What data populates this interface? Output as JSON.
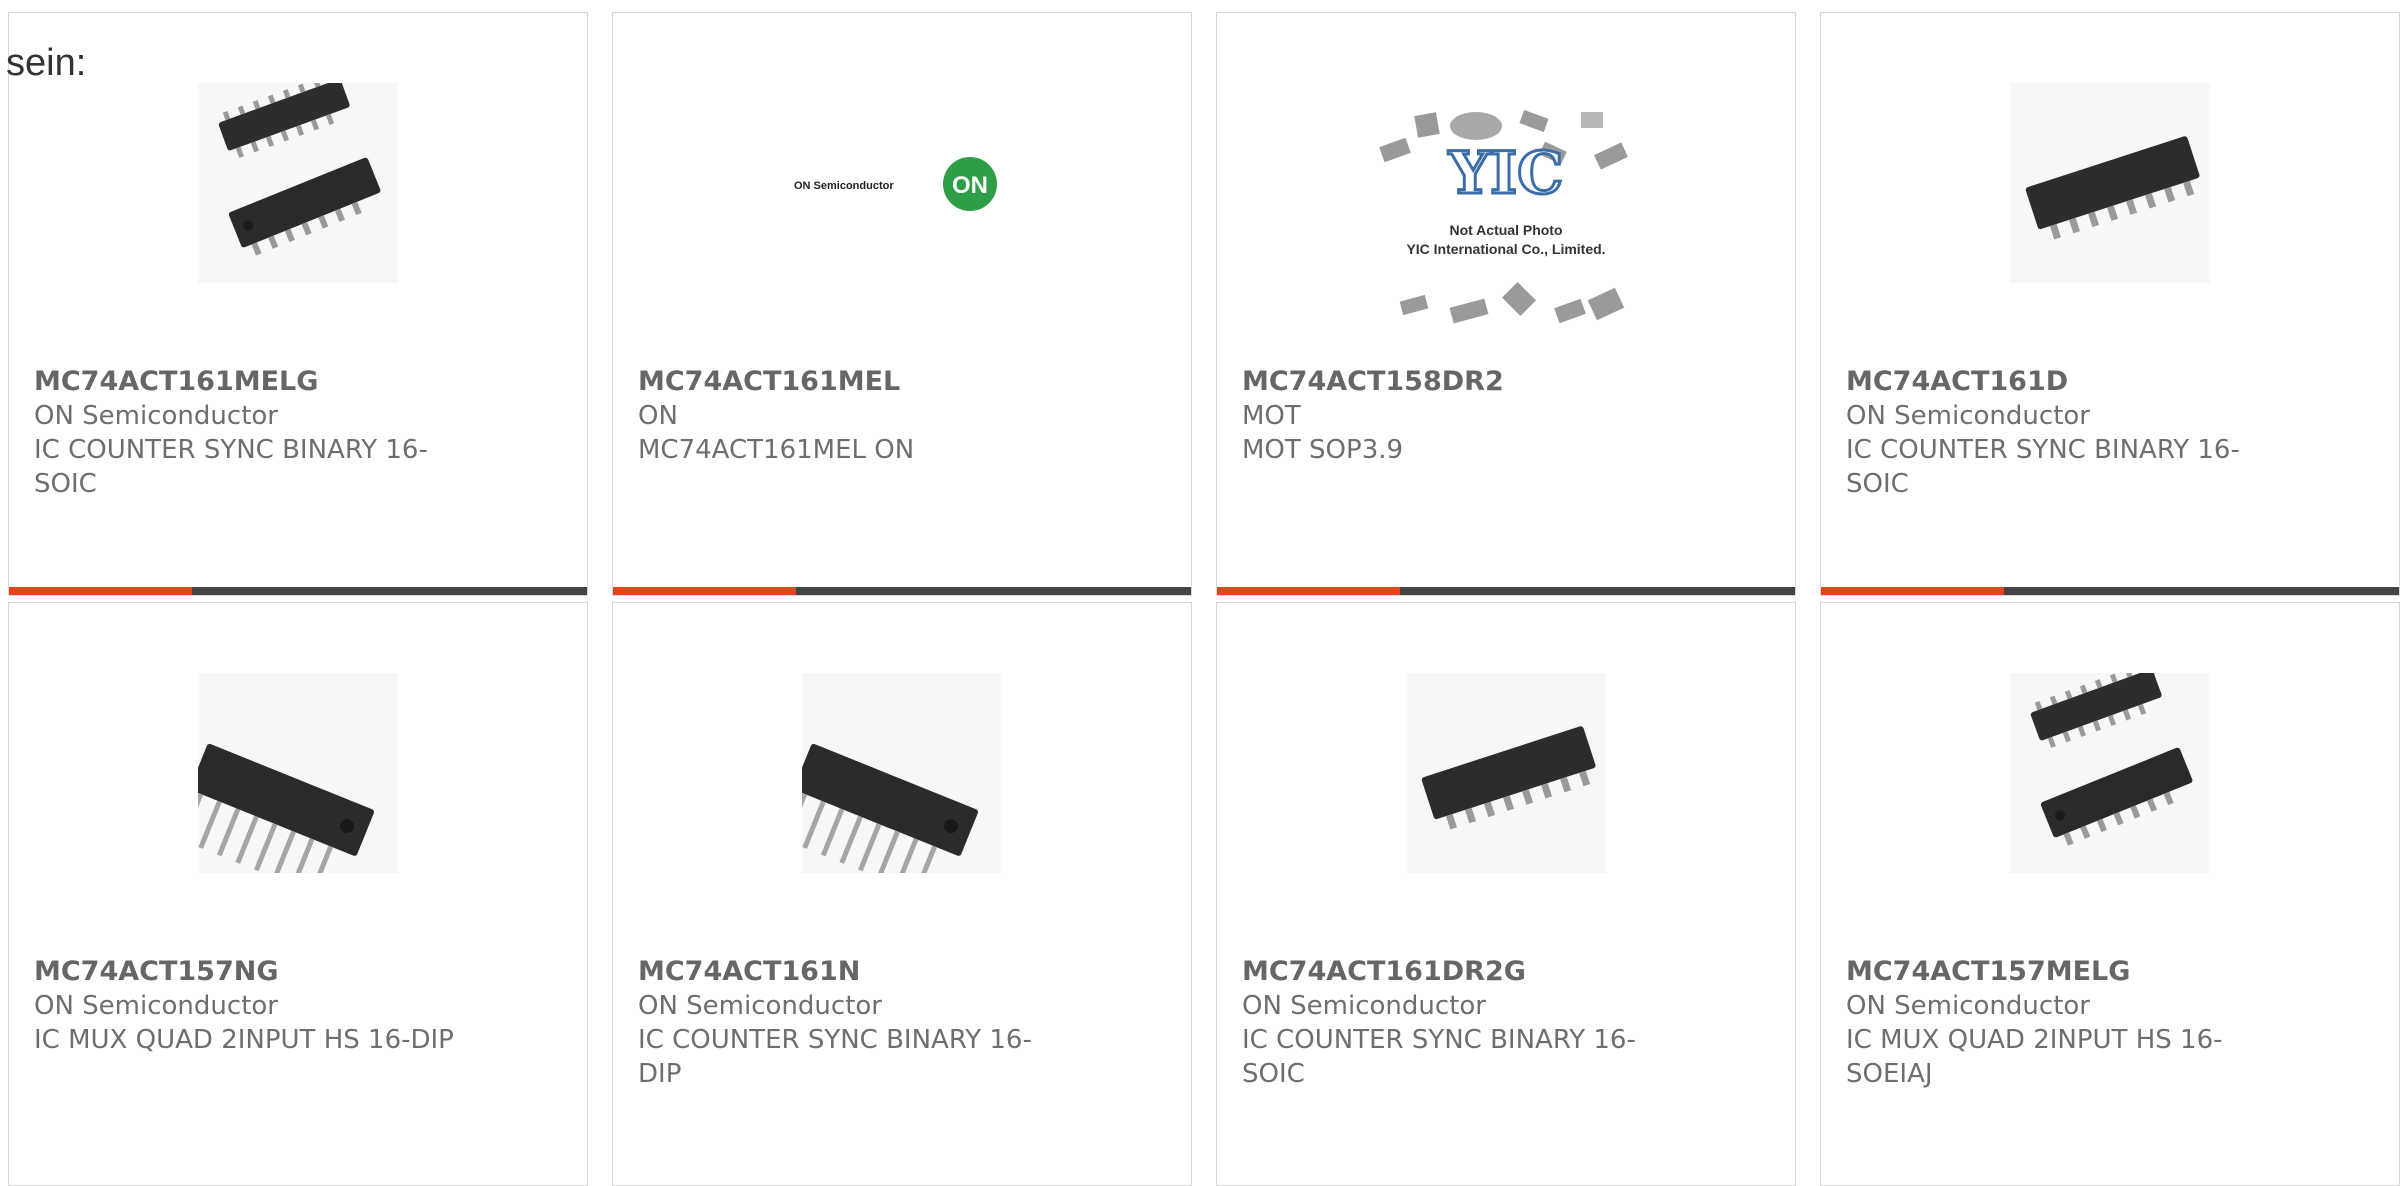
{
  "intro_text": "sein:",
  "accent_color": "#e8431b",
  "bar_color": "#444444",
  "products": [
    {
      "part_number": "MC74ACT161MELG",
      "manufacturer": "ON Semiconductor",
      "description": "IC COUNTER SYNC BINARY 16-SOIC",
      "image": "soic-pair-icon"
    },
    {
      "part_number": "MC74ACT161MEL",
      "manufacturer": "ON",
      "description": "MC74ACT161MEL ON",
      "image": "on-semiconductor-logo"
    },
    {
      "part_number": "MC74ACT158DR2",
      "manufacturer": "MOT",
      "description": "MOT SOP3.9",
      "image": "yic-placeholder",
      "image_caption_1": "Not Actual Photo",
      "image_caption_2": "YIC International Co., Limited."
    },
    {
      "part_number": "MC74ACT161D",
      "manufacturer": "ON Semiconductor",
      "description": "IC COUNTER SYNC BINARY 16-SOIC",
      "image": "soic-single-icon"
    },
    {
      "part_number": "MC74ACT157NG",
      "manufacturer": "ON Semiconductor",
      "description": "IC MUX QUAD 2INPUT HS 16-DIP",
      "image": "dip-icon"
    },
    {
      "part_number": "MC74ACT161N",
      "manufacturer": "ON Semiconductor",
      "description": "IC COUNTER SYNC BINARY 16-DIP",
      "image": "dip-icon"
    },
    {
      "part_number": "MC74ACT161DR2G",
      "manufacturer": "ON Semiconductor",
      "description": "IC COUNTER SYNC BINARY 16-SOIC",
      "image": "soic-single-icon"
    },
    {
      "part_number": "MC74ACT157MELG",
      "manufacturer": "ON Semiconductor",
      "description": "IC MUX QUAD 2INPUT HS 16-SOEIAJ",
      "image": "soic-pair-icon"
    }
  ]
}
